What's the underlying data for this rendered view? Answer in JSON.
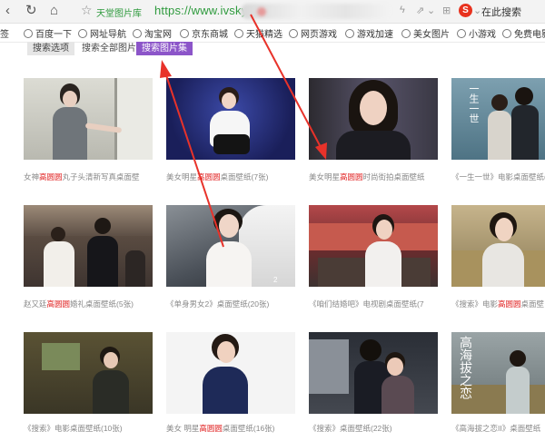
{
  "browser": {
    "site_name": "天堂图片库",
    "url": "https://www.ivsky.c",
    "search_engine_letter": "S",
    "search_placeholder": "在此搜索"
  },
  "bookmarks": [
    "签",
    "百度一下",
    "网址导航",
    "淘宝网",
    "京东商城",
    "天猫精选",
    "网页游戏",
    "游戏加速",
    "美女图片",
    "小游戏",
    "免费电影"
  ],
  "filters": {
    "search_options": "搜索选项",
    "search_all": "搜索全部图片",
    "search_gallery": "搜索图片集"
  },
  "captions": [
    {
      "pre": "女神",
      "hl": "高圆圆",
      "post": "丸子头清新写真桌面壁"
    },
    {
      "pre": "美女明星",
      "hl": "高圆圆",
      "post": "桌面壁纸(7张)"
    },
    {
      "pre": "美女明星",
      "hl": "高圆圆",
      "post": "时尚街拍桌面壁纸"
    },
    {
      "pre": "《一生一世》电影桌面壁纸(",
      "hl": "",
      "post": ""
    },
    {
      "pre": "赵又廷",
      "hl": "高圆圆",
      "post": "婚礼桌面壁纸(5张)"
    },
    {
      "pre": "《单身男女2》桌面壁纸(20张)",
      "hl": "",
      "post": ""
    },
    {
      "pre": "《咱们结婚吧》电视剧桌面壁纸(7",
      "hl": "",
      "post": ""
    },
    {
      "pre": "《搜索》电影",
      "hl": "高圆圆",
      "post": "桌面壁"
    },
    {
      "pre": "《搜索》电影桌面壁纸(10张)",
      "hl": "",
      "post": ""
    },
    {
      "pre": "美女 明星",
      "hl": "高圆圆",
      "post": "桌面壁纸(16张)"
    },
    {
      "pre": "《搜索》桌面壁纸(22张)",
      "hl": "",
      "post": ""
    },
    {
      "pre": "《高海拔之恋II》桌面壁纸",
      "hl": "",
      "post": ""
    }
  ],
  "poster_text": {
    "a": "一生一世",
    "b": "高海拔之恋"
  },
  "colors": {
    "url_green": "#2e9a3d",
    "accent_purple": "#8c55c9",
    "highlight_red": "#e02020",
    "arrow_red": "#e8322a"
  }
}
